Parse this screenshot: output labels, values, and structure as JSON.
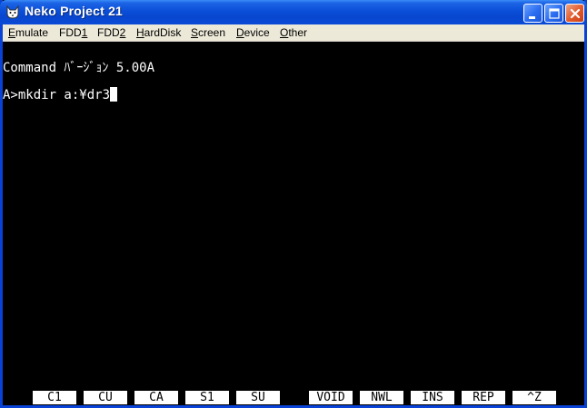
{
  "window": {
    "title": "Neko Project 21",
    "icon": "neko-cat-icon",
    "controls": [
      "minimize-icon",
      "maximize-icon",
      "close-icon"
    ]
  },
  "menubar": {
    "items": [
      "Emulate",
      "FDD1",
      "FDD2",
      "HardDisk",
      "Screen",
      "Device",
      "Other"
    ]
  },
  "console": {
    "line1": "Command ﾊﾞｰｼﾞｮﾝ 5.00A",
    "prompt": "A>mkdir a:¥dr3"
  },
  "function_keys": [
    "C1",
    "CU",
    "CA",
    "S1",
    "SU",
    "VOID",
    "NWL",
    "INS",
    "REP",
    "^Z"
  ],
  "colors": {
    "titlebar": "#0a4fd8",
    "menubar": "#ece9d8",
    "screen_bg": "#000000",
    "text": "#ffffff",
    "close_button": "#e2582a"
  }
}
